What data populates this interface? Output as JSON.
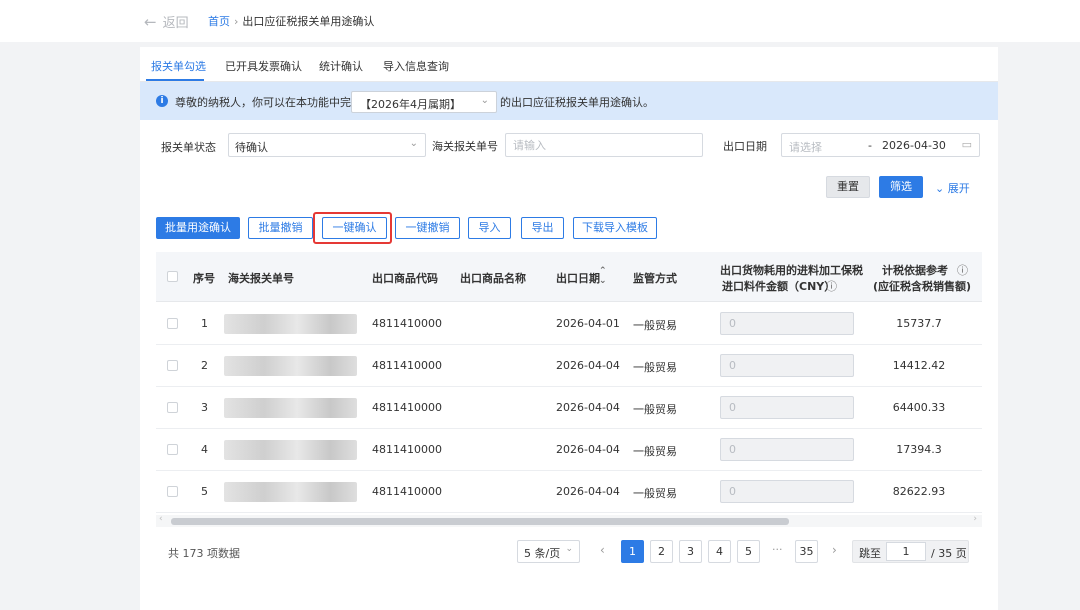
{
  "header": {
    "back_label": "返回",
    "breadcrumb_home": "首页",
    "breadcrumb_current": "出口应征税报关单用途确认"
  },
  "tabs": [
    {
      "label": "报关单勾选",
      "active": true
    },
    {
      "label": "已开具发票确认",
      "active": false
    },
    {
      "label": "统计确认",
      "active": false
    },
    {
      "label": "导入信息查询",
      "active": false
    }
  ],
  "notice": {
    "text_before": "尊敬的纳税人，你可以在本功能中完成",
    "period": "【2026年4月属期】",
    "text_after": "的出口应征税报关单用途确认。"
  },
  "filters": {
    "status_label": "报关单状态",
    "status_value": "待确认",
    "customs_no_label": "海关报关单号",
    "customs_no_placeholder": "请输入",
    "date_label": "出口日期",
    "date_start_placeholder": "请选择",
    "date_separator": "-",
    "date_end": "2026-04-30",
    "reset_label": "重置",
    "filter_label": "筛选",
    "expand_label": "展开"
  },
  "actions": {
    "batch_confirm": "批量用途确认",
    "batch_cancel": "批量撤销",
    "one_click_confirm": "一键确认",
    "one_click_cancel": "一键撤销",
    "import": "导入",
    "export": "导出",
    "download_template": "下载导入模板"
  },
  "table": {
    "headers": {
      "index": "序号",
      "customs_no": "海关报关单号",
      "product_code": "出口商品代码",
      "product_name": "出口商品名称",
      "export_date": "出口日期",
      "supervision": "监管方式",
      "bonded_amount_line1": "出口货物耗用的进料加工保税",
      "bonded_amount_line2": "进口料件金额（CNY）",
      "tax_basis_line1": "计税依据参考",
      "tax_basis_line2": "(应征税含税销售额)"
    },
    "rows": [
      {
        "index": "1",
        "product_code": "4811410000",
        "product_name": "",
        "export_date": "2026-04-01",
        "supervision": "一般贸易",
        "bonded_amount": "0",
        "tax_basis": "15737.7"
      },
      {
        "index": "2",
        "product_code": "4811410000",
        "product_name": "",
        "export_date": "2026-04-04",
        "supervision": "一般贸易",
        "bonded_amount": "0",
        "tax_basis": "14412.42"
      },
      {
        "index": "3",
        "product_code": "4811410000",
        "product_name": "",
        "export_date": "2026-04-04",
        "supervision": "一般贸易",
        "bonded_amount": "0",
        "tax_basis": "64400.33"
      },
      {
        "index": "4",
        "product_code": "4811410000",
        "product_name": "",
        "export_date": "2026-04-04",
        "supervision": "一般贸易",
        "bonded_amount": "0",
        "tax_basis": "17394.3"
      },
      {
        "index": "5",
        "product_code": "4811410000",
        "product_name": "",
        "export_date": "2026-04-04",
        "supervision": "一般贸易",
        "bonded_amount": "0",
        "tax_basis": "82622.93"
      }
    ]
  },
  "pagination": {
    "total_text": "共 173 项数据",
    "page_size": "5 条/页",
    "pages": [
      "1",
      "2",
      "3",
      "4",
      "5"
    ],
    "ellipsis": "···",
    "last_page": "35",
    "jump_label": "跳至",
    "jump_value": "1",
    "total_pages_text": "/ 35 页",
    "current_page": 1
  },
  "colors": {
    "primary": "#2d7be5",
    "notice_bg": "#d9e8fb",
    "highlight": "#e53935"
  }
}
